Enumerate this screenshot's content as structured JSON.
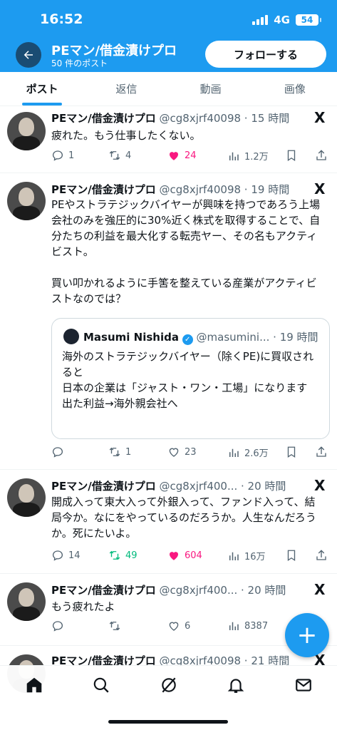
{
  "status_bar": {
    "time": "16:52",
    "network": "4G",
    "battery": "54"
  },
  "header": {
    "title": "PEマン/借金漬けプロ",
    "post_count": "50 件のポスト",
    "follow_label": "フォローする"
  },
  "tabs": [
    {
      "label": "ポスト"
    },
    {
      "label": "返信"
    },
    {
      "label": "動画"
    },
    {
      "label": "画像"
    }
  ],
  "tweets": [
    {
      "name": "PEマン/借金漬けプロ",
      "meta": "@cg8xjrf40098 · 15 時間",
      "text": "疲れた。もう仕事したくない。",
      "replies": "1",
      "retweets": "4",
      "likes": "24",
      "views": "1.2万"
    },
    {
      "name": "PEマン/借金漬けプロ",
      "meta": "@cg8xjrf40098 · 19 時間",
      "text": "PEやストラテジックバイヤーが興味を持つであろう上場会社のみを強圧的に30%近く株式を取得することで、自分たちの利益を最大化する転売ヤー、その名もアクティビスト。\n\n買い叩かれるように手筈を整えている産業がアクティビストなのでは？",
      "quote": {
        "name": "Masumi Nishida",
        "meta": "@masumini... · 19 時間",
        "text": "海外のストラテジックバイヤー（除くPE)に買収されると\n日本の企業は「ジャスト・ワン・工場」になります\n出た利益→海外親会社へ"
      },
      "replies": "",
      "retweets": "1",
      "likes": "23",
      "views": "2.6万"
    },
    {
      "name": "PEマン/借金漬けプロ",
      "meta": "@cg8xjrf400... · 20 時間",
      "text": "開成入って東大入って外銀入って、ファンド入って、結局今か。なにをやっているのだろうか。人生なんだろうか。死にたいよ。",
      "replies": "14",
      "retweets": "49",
      "likes": "604",
      "views": "16万"
    },
    {
      "name": "PEマン/借金漬けプロ",
      "meta": "@cg8xjrf400... · 20 時間",
      "text": "もう疲れたよ",
      "replies": "",
      "retweets": "",
      "likes": "6",
      "views": "8387"
    },
    {
      "name": "PEマン/借金漬けプロ",
      "meta": "@cg8xjrf40098 · 21 時間"
    }
  ],
  "icons": {
    "x_logo": "X",
    "fab": "+",
    "verified": "✓"
  },
  "colors": {
    "brand": "#1d9bf0",
    "like": "#f91880",
    "retweet": "#00ba7c",
    "text": "#0f1419",
    "muted": "#536471"
  }
}
